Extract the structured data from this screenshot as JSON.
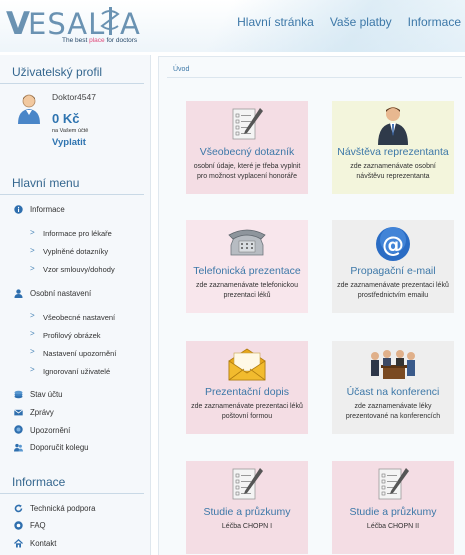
{
  "brand": {
    "word": "VESALIA",
    "tagline_pre": "The best ",
    "tagline_hl": "place",
    "tagline_post": " for doctors"
  },
  "topnav": [
    "Hlavní stránka",
    "Vaše platby",
    "Informace"
  ],
  "profile": {
    "title": "Uživatelský profil",
    "username": "Doktor4547",
    "balance": "0 Kč",
    "balance_note": "na Vašem účtě",
    "payout": "Vyplatit"
  },
  "main_menu": {
    "title": "Hlavní menu",
    "info": "Informace",
    "info_sub": [
      "Informace pro lékaře",
      "Vyplněné dotazníky",
      "Vzor smlouvy/dohody"
    ],
    "settings": "Osobní nastavení",
    "settings_sub": [
      "Všeobecné nastavení",
      "Profilový obrázek",
      "Nastavení upozornění",
      "Ignorovaní uživatelé"
    ],
    "account": "Stav účtu",
    "messages": "Zprávy",
    "notifications": "Upozornění",
    "recommend": "Doporučit kolegu"
  },
  "info_menu": {
    "title": "Informace",
    "items": [
      "Technická podpora",
      "FAQ",
      "Kontakt"
    ]
  },
  "breadcrumb": "Úvod",
  "tiles": [
    {
      "title": "Všeobecný dotazník",
      "desc": "osobní údaje, které je třeba vyplnit pro možnost vyplacení honoráře",
      "icon": "questionnaire-icon",
      "bg": "#f4dde4"
    },
    {
      "title": "Návštěva reprezentanta",
      "desc": "zde zaznamenávate osobní návštěvu reprezentanta",
      "icon": "representative-icon",
      "bg": "#f3f5dc"
    },
    {
      "title": "Telefonická prezentace",
      "desc": "zde zaznamenávate telefonickou prezentaci léků",
      "icon": "telephone-icon",
      "bg": "#f8e6ec"
    },
    {
      "title": "Propagační e-mail",
      "desc": "zde zaznamenávate prezentaci léků prostřednictvím emailu",
      "icon": "email-icon",
      "bg": "#eeeeee"
    },
    {
      "title": "Prezentační dopis",
      "desc": "zde zaznamenávate prezentaci léků poštovní formou",
      "icon": "letter-icon",
      "bg": "#f4dde4"
    },
    {
      "title": "Účast na konferenci",
      "desc": "zde zaznamenávate léky prezentované na konferencích",
      "icon": "conference-icon",
      "bg": "#eeeeee"
    },
    {
      "title": "Studie a průzkumy",
      "desc": "Léčba CHOPN I",
      "icon": "questionnaire-icon",
      "bg": "#f4dde4"
    },
    {
      "title": "Studie a průzkumy",
      "desc": "Léčba CHOPN II",
      "icon": "questionnaire-icon",
      "bg": "#f4dde4"
    }
  ]
}
